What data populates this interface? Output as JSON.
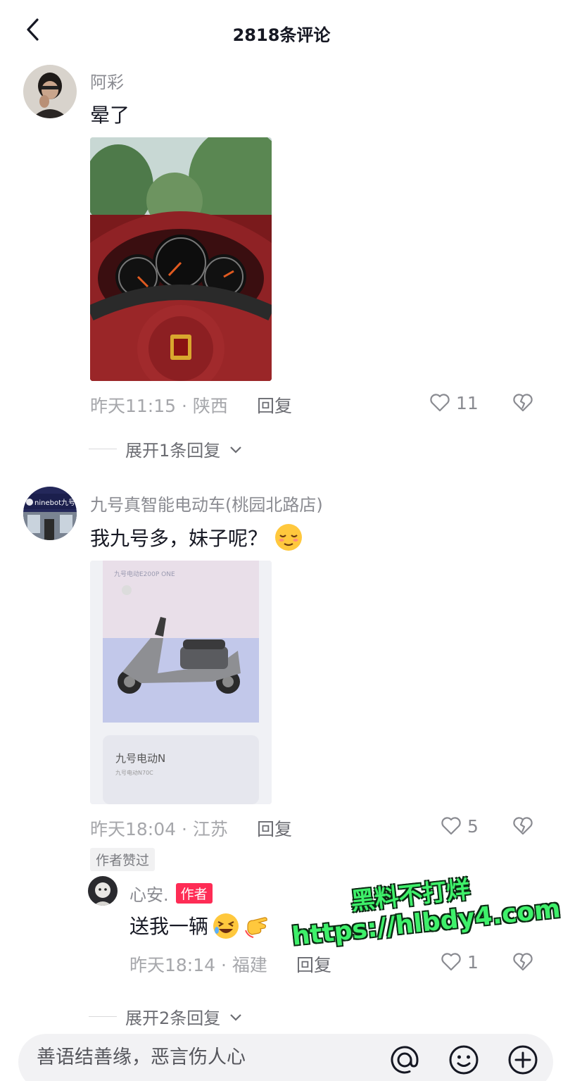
{
  "header": {
    "title": "2818条评论"
  },
  "comments": [
    {
      "user": "阿彩",
      "text": "晕了",
      "time_loc": "昨天11:15 · 陕西",
      "reply_label": "回复",
      "likes": "11",
      "expand_label": "展开1条回复"
    },
    {
      "user": "九号真智能电动车(桃园北路店)",
      "text": "我九号多，妹子呢？",
      "avatar_text": "ninebot九号",
      "image_text": {
        "card_title": "九号电动N",
        "card_sub": "九号电动N70C",
        "top_small": "九号电动E200P ONE"
      },
      "time_loc": "昨天18:04 · 江苏",
      "reply_label": "回复",
      "likes": "5",
      "badge": "作者赞过",
      "reply": {
        "user": "心安.",
        "author_tag": "作者",
        "text": "送我一辆",
        "time_loc": "昨天18:14 · 福建",
        "reply_label": "回复",
        "likes": "1"
      },
      "expand_label": "展开2条回复"
    }
  ],
  "watermark": {
    "line1": "黑料不打烊",
    "line2": "https://hlbdy4.com"
  },
  "input": {
    "placeholder": "善语结善缘，恶言伤人心"
  },
  "colors": {
    "accent": "#fe2c55",
    "watermark": "#3ef06a"
  }
}
